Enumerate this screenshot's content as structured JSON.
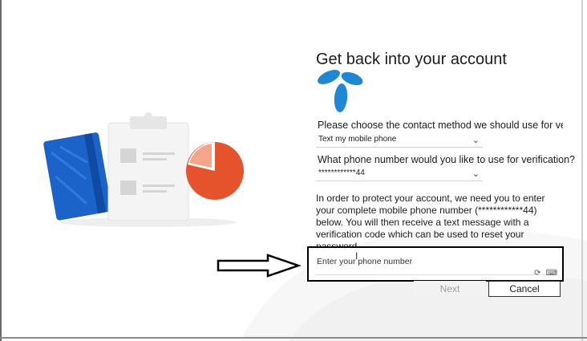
{
  "title": "Get back into your account",
  "contact_method": {
    "label": "Please choose the contact method we should use for verification:",
    "selected": "Text my mobile phone"
  },
  "phone_select": {
    "label": "What phone number would you like to use for verification?",
    "selected": "************44"
  },
  "instructions": "In order to protect your account, we need you to enter your complete mobile phone number (************44) below. You will then receive a text message with a verification code which can be used to reset your password.",
  "phone_input": {
    "placeholder": "Enter your phone number",
    "value": ""
  },
  "buttons": {
    "next": "Next",
    "cancel": "Cancel"
  },
  "colors": {
    "logo_blue": "#1e88d6",
    "book_blue": "#1b63c9",
    "pie_orange": "#e5532c",
    "highlight_border": "#000000"
  }
}
